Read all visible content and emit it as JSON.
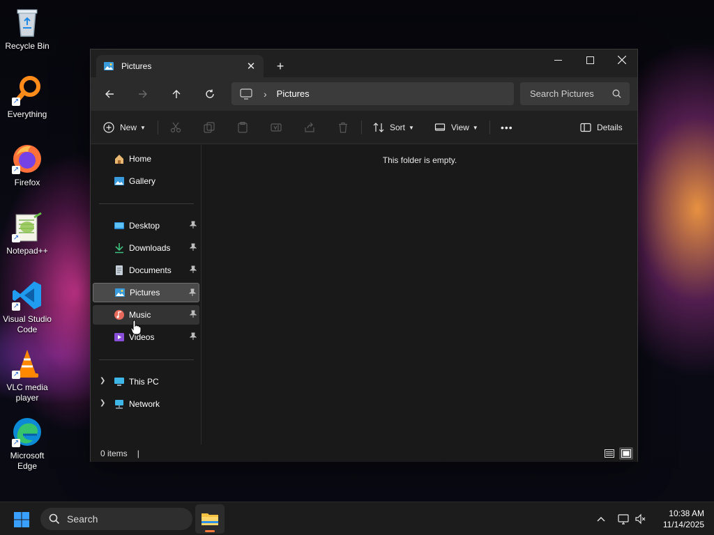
{
  "desktop": {
    "icons": [
      {
        "label": "Recycle Bin"
      },
      {
        "label": "Everything"
      },
      {
        "label": "Firefox"
      },
      {
        "label": "Notepad++"
      },
      {
        "label": "Visual Studio Code"
      },
      {
        "label": "VLC media player"
      },
      {
        "label": "Microsoft Edge"
      }
    ]
  },
  "window": {
    "tab_title": "Pictures",
    "address": {
      "crumb": "Pictures"
    },
    "search_placeholder": "Search Pictures",
    "toolbar": {
      "new_label": "New",
      "sort_label": "Sort",
      "view_label": "View",
      "more_label": "•••",
      "details_label": "Details"
    },
    "nav": {
      "home": "Home",
      "gallery": "Gallery",
      "desktop": "Desktop",
      "downloads": "Downloads",
      "documents": "Documents",
      "pictures": "Pictures",
      "music": "Music",
      "videos": "Videos",
      "this_pc": "This PC",
      "network": "Network"
    },
    "empty_message": "This folder is empty.",
    "status_text": "0 items"
  },
  "taskbar": {
    "search_placeholder": "Search",
    "time": "10:38 AM",
    "date": "11/14/2025"
  },
  "colors": {
    "accent": "#0078d4",
    "window_bg": "#191919",
    "titlebar_bg": "#202020",
    "selected_item": "#4a4a4a"
  }
}
